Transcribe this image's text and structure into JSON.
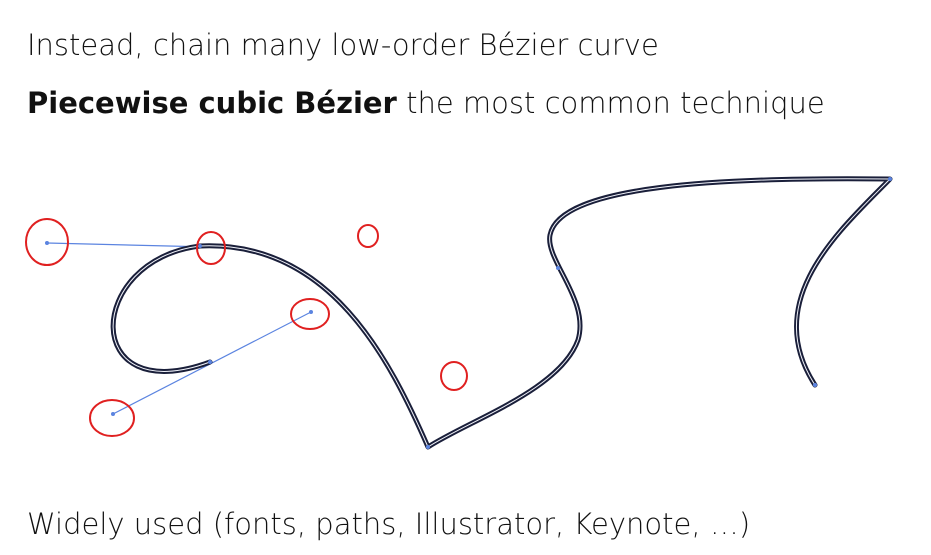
{
  "slide": {
    "line1": "Instead, chain many low-order Bézier curve",
    "line2_bold": "Piecewise cubic Bézier",
    "line2_rest": " the most common technique",
    "line3": "Widely used (fonts, paths, Illustrator, Keynote, …)"
  },
  "figure": {
    "curve_color": "#1a1f3a",
    "handle_color": "#5b84e0",
    "marker_color": "#e02020"
  }
}
